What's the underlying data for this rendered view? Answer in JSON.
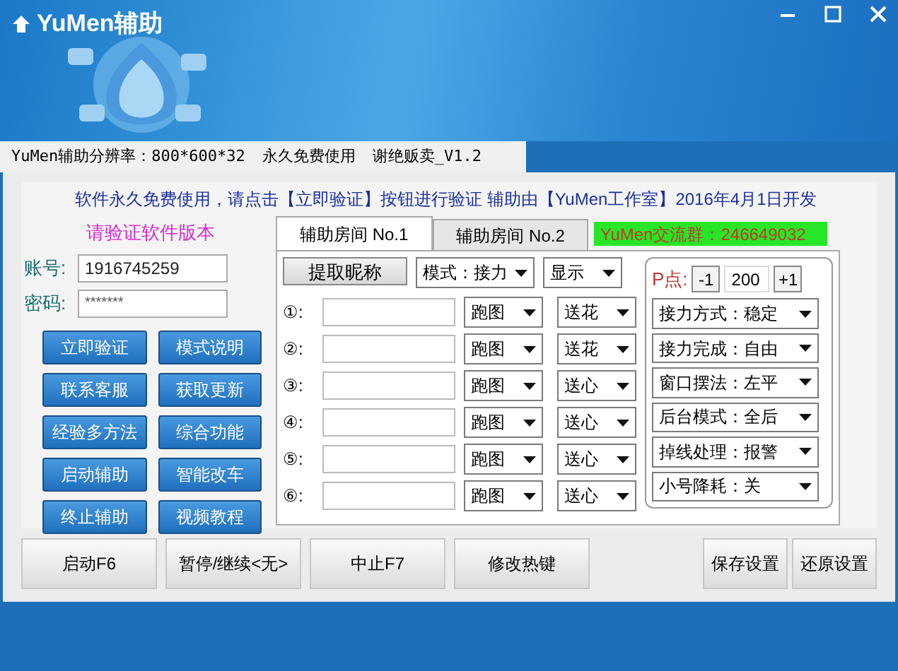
{
  "window": {
    "title": "YuMen辅助"
  },
  "info_bar": [
    "YuMen辅助分辨率：800*600*32",
    "永久免费使用",
    "谢绝贩卖_V1.2"
  ],
  "notice": "软件永久免费使用，请点击【立即验证】按钮进行验证 辅助由【YuMen工作室】2016年4月1日开发",
  "login": {
    "heading": "请验证软件版本",
    "account_label": "账号:",
    "account": "1916745259",
    "password_label": "密码:",
    "password": "*******"
  },
  "left_buttons": [
    "立即验证",
    "模式说明",
    "联系客服",
    "获取更新",
    "经验多方法",
    "综合功能",
    "启动辅助",
    "智能改车",
    "终止辅助",
    "视频教程"
  ],
  "tabs": [
    {
      "label": "辅助房间 No.1",
      "selected": true
    },
    {
      "label": "辅助房间 No.2",
      "selected": false
    }
  ],
  "group_label": "YuMen交流群：246649032",
  "room": {
    "fetch_button": "提取昵称",
    "mode": "模式：接力",
    "display": "显示",
    "slots": [
      {
        "label": "①:",
        "action": "跑图",
        "gift": "送花"
      },
      {
        "label": "②:",
        "action": "跑图",
        "gift": "送花"
      },
      {
        "label": "③:",
        "action": "跑图",
        "gift": "送心"
      },
      {
        "label": "④:",
        "action": "跑图",
        "gift": "送心"
      },
      {
        "label": "⑤:",
        "action": "跑图",
        "gift": "送心"
      },
      {
        "label": "⑥:",
        "action": "跑图",
        "gift": "送心"
      }
    ]
  },
  "settings": {
    "p_label": "P点:",
    "minus": "-1",
    "value": "200",
    "plus": "+1",
    "options": [
      "接力方式：稳定",
      "接力完成：自由",
      "窗口摆法：左平",
      "后台模式：全后",
      "掉线处理：报警",
      "小号降耗：关"
    ]
  },
  "bottom_buttons": {
    "left": [
      "启动F6",
      "暂停/继续<无>",
      "中止F7",
      "修改热键"
    ],
    "right": [
      "保存设置",
      "还原设置"
    ]
  }
}
